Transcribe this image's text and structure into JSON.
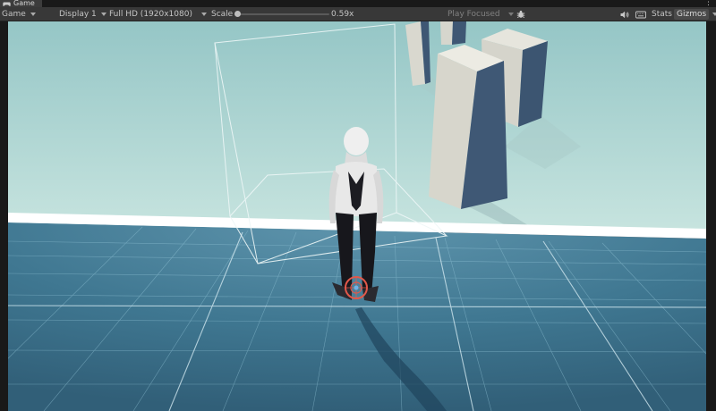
{
  "window": {
    "tab_label": "Game"
  },
  "toolbar": {
    "view_mode": "Game",
    "display": "Display 1",
    "resolution": "Full HD (1920x1080)",
    "scale_label": "Scale",
    "scale_value": "0.59x",
    "scale_fraction": 0.0,
    "play_mode": "Play Focused",
    "stats_label": "Stats",
    "gizmos_label": "Gizmos"
  },
  "icons": [
    "game-controller-icon",
    "more-options-icon",
    "bug-icon",
    "mute-audio-icon",
    "shortcut-keyboard-icon"
  ],
  "colors": {
    "sky": "#a8d6d2",
    "ground": "#3b6f8a",
    "ground_far": "#5e93ac",
    "pillar_light": "#d8d7cf",
    "pillar_dark": "#3d5672",
    "wall_trim": "#ffffff",
    "bounds": "#e6f2f3",
    "target_marker": "#e2584a"
  }
}
